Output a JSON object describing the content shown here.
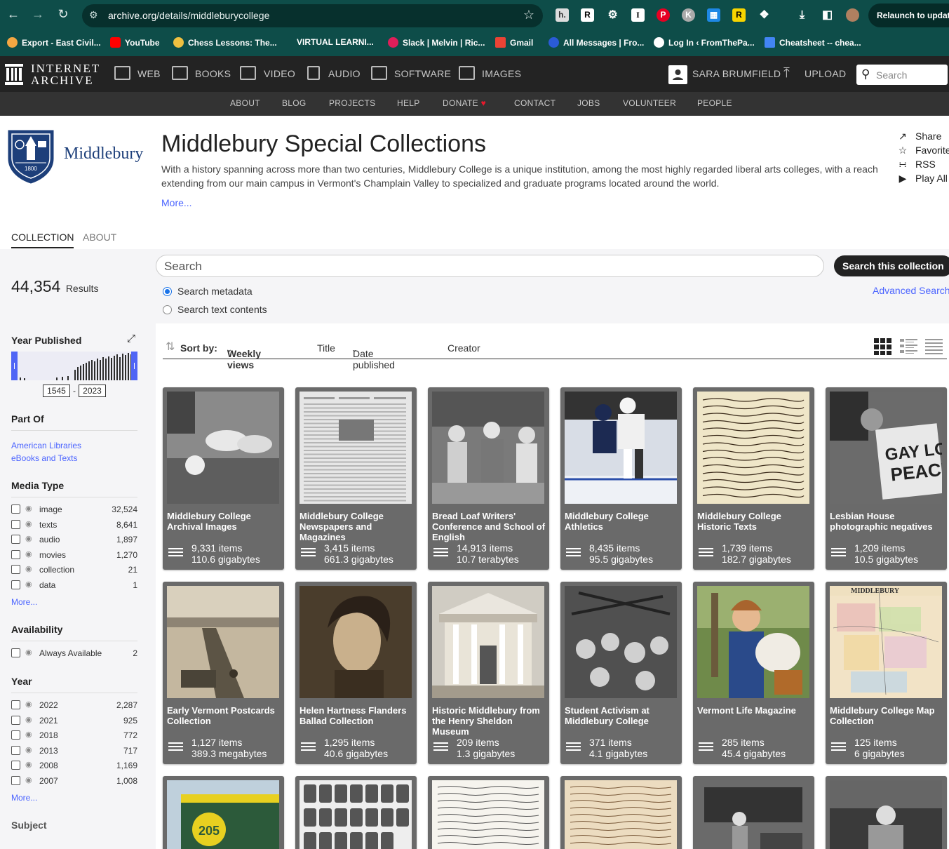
{
  "browser": {
    "url_domain": "archive.org",
    "url_path": "/details/middleburycollege",
    "relaunch_label": "Relaunch to update",
    "bookmarks": [
      "Export - East Civil...",
      "YouTube",
      "Chess Lessons: The...",
      "VIRTUAL LEARNI...",
      "Slack | Melvin | Ric...",
      "Gmail",
      "All Messages | Fro...",
      "Log In ‹ FromThePa...",
      "Cheatsheet -- chea..."
    ]
  },
  "ia_header": {
    "logo_line1": "INTERNET",
    "logo_line2": "ARCHIVE",
    "nav": [
      "WEB",
      "BOOKS",
      "VIDEO",
      "AUDIO",
      "SOFTWARE",
      "IMAGES"
    ],
    "user": "SARA BRUMFIELD",
    "upload": "UPLOAD",
    "search_placeholder": "Search",
    "subnav": [
      "ABOUT",
      "BLOG",
      "PROJECTS",
      "HELP",
      "DONATE",
      "CONTACT",
      "JOBS",
      "VOLUNTEER",
      "PEOPLE"
    ]
  },
  "collection": {
    "logo_text": "Middlebury",
    "logo_year": "1800",
    "title": "Middlebury Special Collections",
    "description": "With a history spanning across more than two centuries, Middlebury College is a unique institution, among the most highly regarded liberal arts colleges, with a reach extending from our main campus in Vermont's Champlain Valley to specialized and graduate programs located around the world.",
    "more": "More...",
    "actions": [
      "Share",
      "Favorite",
      "RSS",
      "Play All"
    ]
  },
  "tabs": [
    "COLLECTION",
    "ABOUT"
  ],
  "results": {
    "count": "44,354",
    "label": "Results"
  },
  "search": {
    "placeholder": "Search",
    "button": "Search this collection",
    "advanced": "Advanced Search",
    "options": [
      "Search metadata",
      "Search text contents"
    ]
  },
  "facets": {
    "year_published": {
      "title": "Year Published",
      "min": "1545",
      "max": "2023"
    },
    "part_of": {
      "title": "Part Of",
      "items": [
        "American Libraries",
        "eBooks and Texts"
      ]
    },
    "media_type": {
      "title": "Media Type",
      "rows": [
        [
          "image",
          "32,524"
        ],
        [
          "texts",
          "8,641"
        ],
        [
          "audio",
          "1,897"
        ],
        [
          "movies",
          "1,270"
        ],
        [
          "collection",
          "21"
        ],
        [
          "data",
          "1"
        ]
      ],
      "more": "More..."
    },
    "availability": {
      "title": "Availability",
      "rows": [
        [
          "Always Available",
          "2"
        ]
      ]
    },
    "year": {
      "title": "Year",
      "rows": [
        [
          "2022",
          "2,287"
        ],
        [
          "2021",
          "925"
        ],
        [
          "2018",
          "772"
        ],
        [
          "2013",
          "717"
        ],
        [
          "2008",
          "1,169"
        ],
        [
          "2007",
          "1,008"
        ]
      ],
      "more": "More..."
    },
    "subject": {
      "title": "Subject"
    }
  },
  "sort": {
    "label": "Sort by:",
    "options": [
      "Weekly views",
      "Title",
      "Date published",
      "Creator"
    ]
  },
  "tiles": [
    {
      "title": "Middlebury College Archival Images",
      "items": "9,331 items",
      "size": "110.6 gigabytes"
    },
    {
      "title": "Middlebury College Newspapers and Magazines",
      "items": "3,415 items",
      "size": "661.3 gigabytes"
    },
    {
      "title": "Bread Loaf Writers' Conference and School of English",
      "items": "14,913 items",
      "size": "10.7 terabytes"
    },
    {
      "title": "Middlebury College Athletics",
      "items": "8,435 items",
      "size": "95.5 gigabytes"
    },
    {
      "title": "Middlebury College Historic Texts",
      "items": "1,739 items",
      "size": "182.7 gigabytes"
    },
    {
      "title": "Lesbian House photographic negatives",
      "items": "1,209 items",
      "size": "10.5 gigabytes"
    },
    {
      "title": "Early Vermont Postcards Collection",
      "items": "1,127 items",
      "size": "389.3 megabytes"
    },
    {
      "title": "Helen Hartness Flanders Ballad Collection",
      "items": "1,295 items",
      "size": "40.6 gigabytes"
    },
    {
      "title": "Historic Middlebury from the Henry Sheldon Museum",
      "items": "209 items",
      "size": "1.3 gigabytes"
    },
    {
      "title": "Student Activism at Middlebury College",
      "items": "371 items",
      "size": "4.1 gigabytes"
    },
    {
      "title": "Vermont Life Magazine",
      "items": "285 items",
      "size": "45.4 gigabytes"
    },
    {
      "title": "Middlebury College Map Collection",
      "items": "125 items",
      "size": "6 gigabytes"
    }
  ]
}
